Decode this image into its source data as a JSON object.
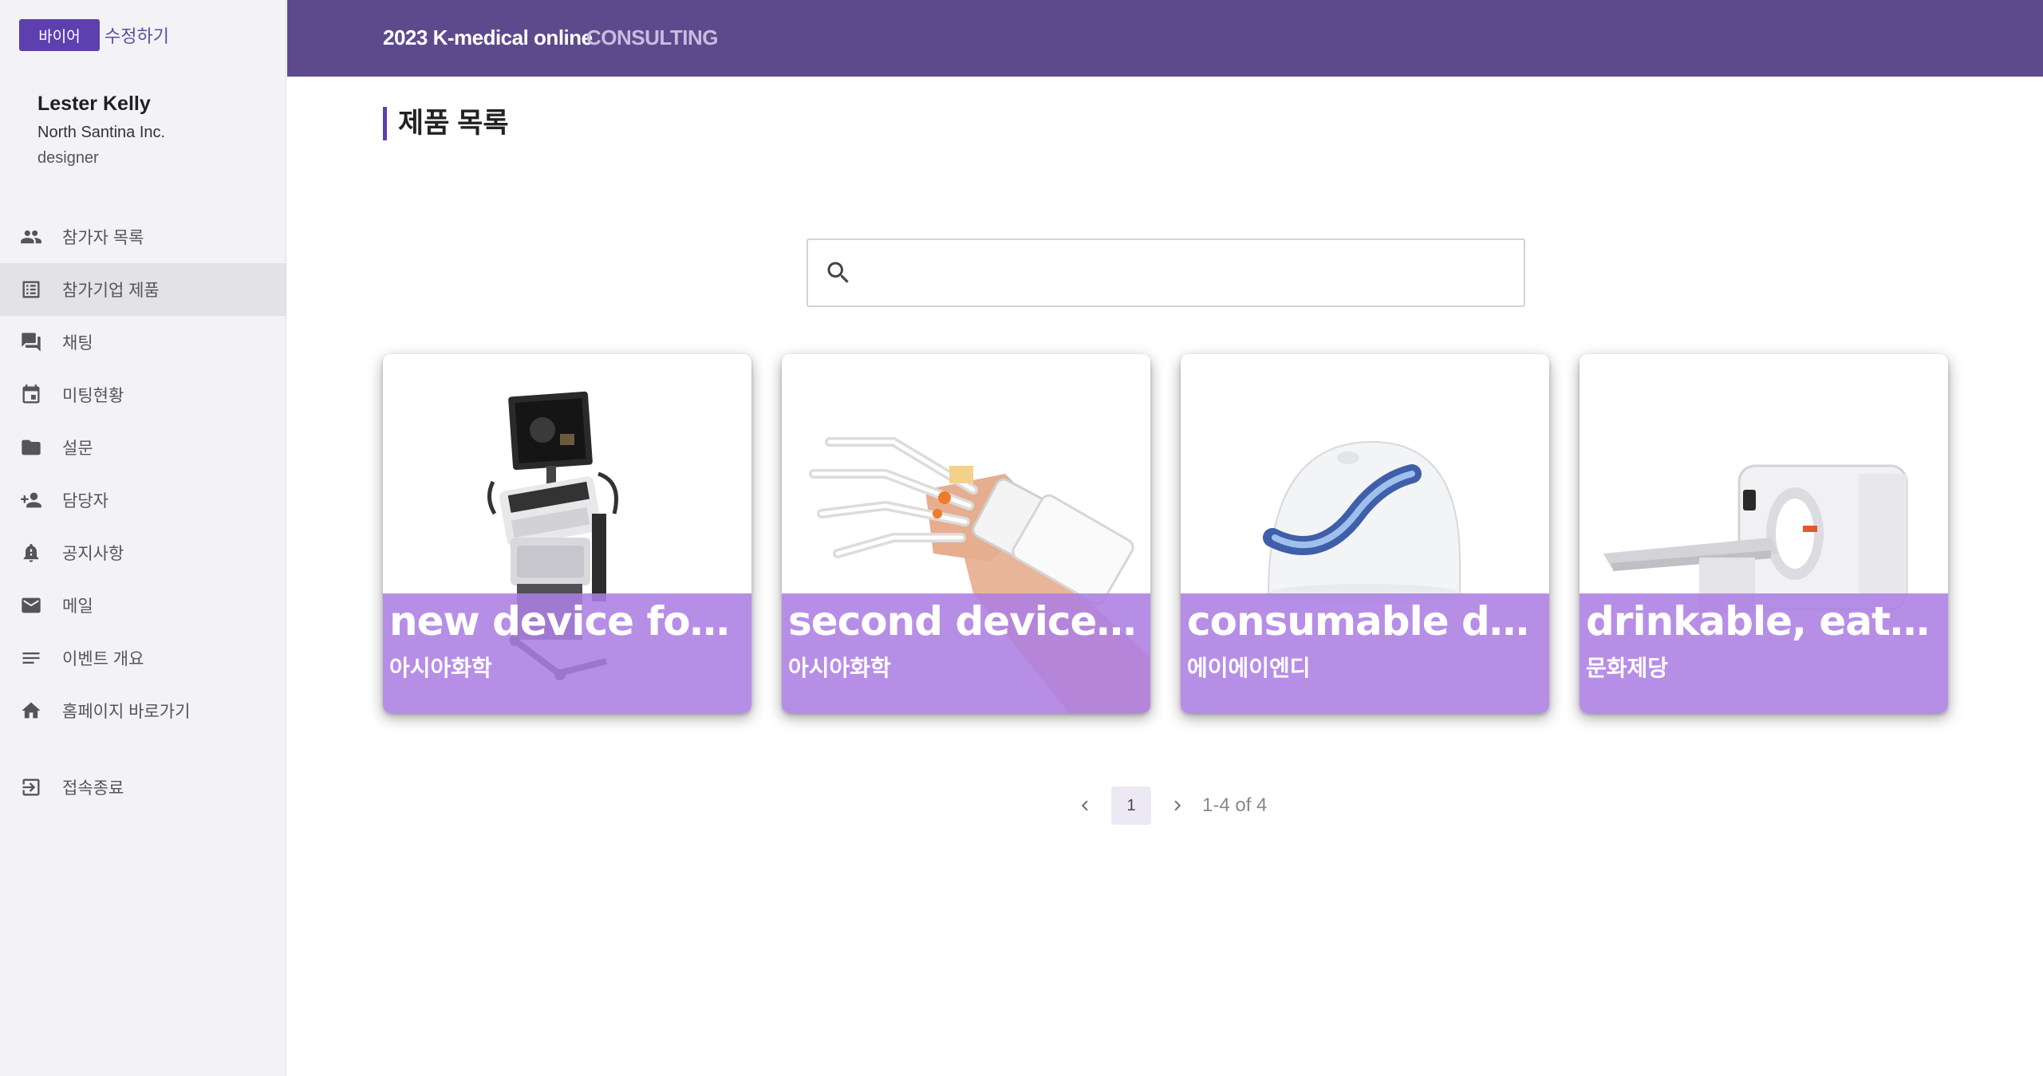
{
  "sidebar": {
    "role_badge": "바이어",
    "edit_link": "수정하기",
    "profile": {
      "name": "Lester Kelly",
      "company": "North Santina Inc.",
      "job": "designer"
    },
    "items": [
      {
        "label": "참가자 목록",
        "icon": "people-icon"
      },
      {
        "label": "참가기업 제품",
        "icon": "list-icon",
        "active": true
      },
      {
        "label": "채팅",
        "icon": "chat-icon"
      },
      {
        "label": "미팅현황",
        "icon": "calendar-icon"
      },
      {
        "label": "설문",
        "icon": "label-icon"
      },
      {
        "label": "담당자",
        "icon": "person-add-icon"
      },
      {
        "label": "공지사항",
        "icon": "notification-icon"
      },
      {
        "label": "메일",
        "icon": "mail-icon"
      },
      {
        "label": "이벤트 개요",
        "icon": "notes-icon"
      },
      {
        "label": "홈페이지 바로가기",
        "icon": "home-icon"
      }
    ],
    "logout": {
      "label": "접속종료",
      "icon": "logout-icon"
    }
  },
  "header": {
    "title": "2023 K-medical online",
    "subtitle": "CONSULTING"
  },
  "main": {
    "page_title": "제품 목록",
    "search": {
      "placeholder": ""
    },
    "products": [
      {
        "name": "new device for C...",
        "company": "아시아화학",
        "image": "ultrasound-machine"
      },
      {
        "name": "second device fo...",
        "company": "아시아화학",
        "image": "rehab-glove"
      },
      {
        "name": "consumable device",
        "company": "에이에이엔디",
        "image": "helmet-device"
      },
      {
        "name": "drinkable, eatabl...",
        "company": "문화제당",
        "image": "ct-scanner"
      }
    ],
    "pagination": {
      "current_page": "1",
      "range_text": "1-4 of 4"
    }
  },
  "colors": {
    "header_bg": "#5d4a8c",
    "accent": "#5d3fb0",
    "card_overlay": "#ad7ee2"
  }
}
